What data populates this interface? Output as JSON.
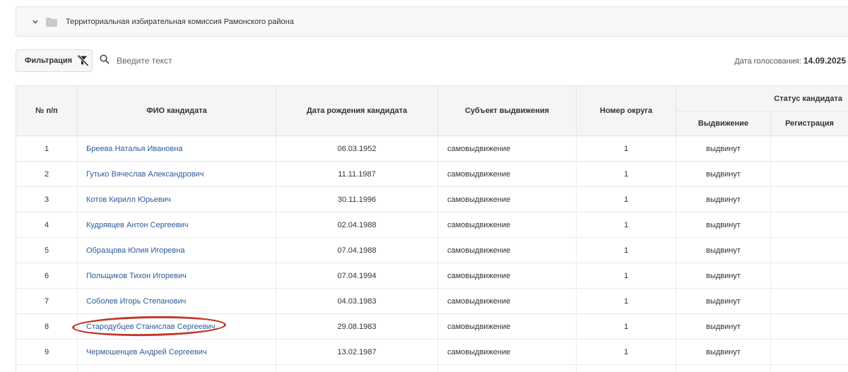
{
  "commission": {
    "title": "Территориальная избирательная комиссия Рамонского района"
  },
  "toolbar": {
    "filter_label": "Фильтрация",
    "search_placeholder": "Введите текст",
    "vote_date_label": "Дата голосования:",
    "vote_date_value": "14.09.2025"
  },
  "table": {
    "headers": {
      "num": "№ п/п",
      "name": "ФИО кандидата",
      "birth": "Дата рождения кандидата",
      "subject": "Субъект выдвижения",
      "district": "Номер округа",
      "status": "Статус кандидата",
      "nomination": "Выдвижение",
      "registration": "Регистрация"
    },
    "rows": [
      {
        "num": "1",
        "name": "Бреева Наталья Ивановна",
        "birth": "06.03.1952",
        "subject": "самовыдвижение",
        "district": "1",
        "nomination": "выдвинут",
        "registration": ""
      },
      {
        "num": "2",
        "name": "Гутько Вячеслав Александрович",
        "birth": "11.11.1987",
        "subject": "самовыдвижение",
        "district": "1",
        "nomination": "выдвинут",
        "registration": ""
      },
      {
        "num": "3",
        "name": "Котов Кирилл Юрьевич",
        "birth": "30.11.1996",
        "subject": "самовыдвижение",
        "district": "1",
        "nomination": "выдвинут",
        "registration": ""
      },
      {
        "num": "4",
        "name": "Кудрявцев Антон Сергеевич",
        "birth": "02.04.1988",
        "subject": "самовыдвижение",
        "district": "1",
        "nomination": "выдвинут",
        "registration": ""
      },
      {
        "num": "5",
        "name": "Образцова Юлия Игоревна",
        "birth": "07.04.1988",
        "subject": "самовыдвижение",
        "district": "1",
        "nomination": "выдвинут",
        "registration": ""
      },
      {
        "num": "6",
        "name": "Польщиков Тихон Игоревич",
        "birth": "07.04.1994",
        "subject": "самовыдвижение",
        "district": "1",
        "nomination": "выдвинут",
        "registration": ""
      },
      {
        "num": "7",
        "name": "Соболев Игорь Степанович",
        "birth": "04.03.1983",
        "subject": "самовыдвижение",
        "district": "1",
        "nomination": "выдвинут",
        "registration": ""
      },
      {
        "num": "8",
        "name": "Стародубцев Станислав Сергеевич",
        "birth": "29.08.1983",
        "subject": "самовыдвижение",
        "district": "1",
        "nomination": "выдвинут",
        "registration": "",
        "circled": true
      },
      {
        "num": "9",
        "name": "Чермошенцев Андрей Сергеевич",
        "birth": "13.02.1987",
        "subject": "самовыдвижение",
        "district": "1",
        "nomination": "выдвинут",
        "registration": ""
      }
    ]
  },
  "colors": {
    "link": "#2d5a9a",
    "highlight_circle": "#c0392b",
    "header_bg": "#f5f5f5"
  },
  "icons": {
    "expand": "chevron-down-icon",
    "folder": "folder-icon",
    "filter": "filter-off-icon",
    "search": "search-icon"
  }
}
